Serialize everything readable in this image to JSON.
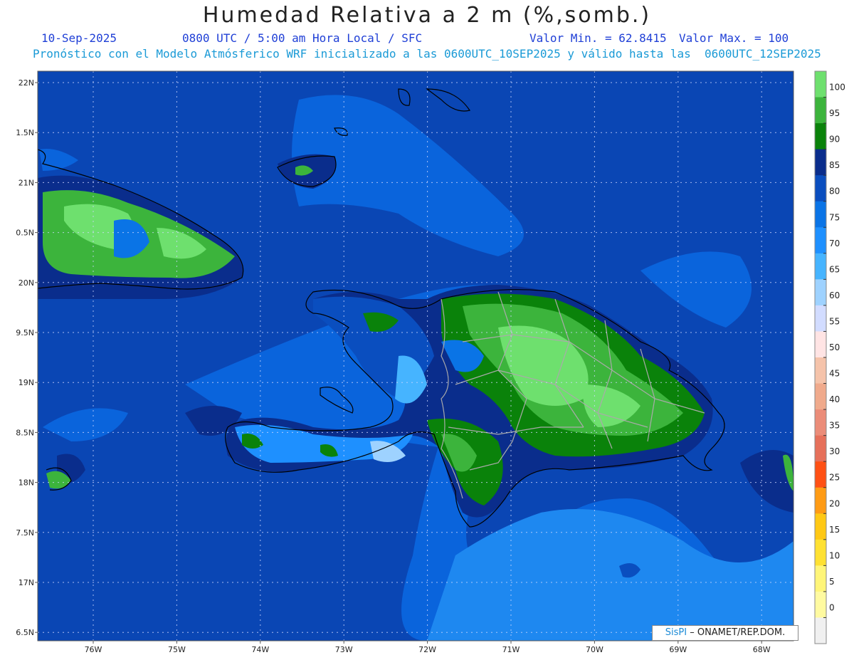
{
  "header": {
    "title": "Humedad Relativa a 2 m (%,somb.)",
    "date": "10-Sep-2025",
    "time": "0800 UTC / 5:00 am Hora Local / SFC",
    "min": "Valor Min. = 62.8415",
    "max": "Valor Max. = 100",
    "forecast": "Pronóstico con el Modelo Atmósferico WRF inicializado a las 0600UTC_10SEP2025 y válido hasta las  0600UTC_12SEP2025"
  },
  "axes": {
    "lat_labels": [
      "22N",
      "1.5N",
      "21N",
      "0.5N",
      "20N",
      "9.5N",
      "19N",
      "8.5N",
      "18N",
      "7.5N",
      "17N",
      "6.5N"
    ],
    "lon_labels": [
      "76W",
      "75W",
      "74W",
      "73W",
      "72W",
      "71W",
      "70W",
      "69W",
      "68W"
    ]
  },
  "colorbar": {
    "labels": [
      "100",
      "95",
      "90",
      "85",
      "80",
      "75",
      "70",
      "65",
      "60",
      "55",
      "50",
      "45",
      "40",
      "35",
      "30",
      "25",
      "20",
      "15",
      "10",
      "5",
      "0"
    ],
    "colors": [
      "#6ee06e",
      "#3cb43c",
      "#0a820a",
      "#0a2d8c",
      "#0a4ebf",
      "#0a74e6",
      "#1e90ff",
      "#46b4ff",
      "#9ed2ff",
      "#d2dcff",
      "#ffe4e4",
      "#f5c3aa",
      "#f0aa8c",
      "#eb8c78",
      "#e6705a",
      "#ff5014",
      "#ff9b14",
      "#ffc814",
      "#ffe132",
      "#fff578",
      "#fffaa0",
      "#f0f0f0"
    ]
  },
  "colors": {
    "ocean_dark": "#0a46b4",
    "ocean_mid": "#0a64dc",
    "ocean_light": "#1e88f0",
    "land_green": "#0a820a",
    "land_mid": "#3cb43c",
    "land_light": "#6ee06e",
    "boundary": "#aaaaaa"
  },
  "credit": {
    "logo": "SisPI",
    "text": "– ONAMET/REP.DOM."
  }
}
